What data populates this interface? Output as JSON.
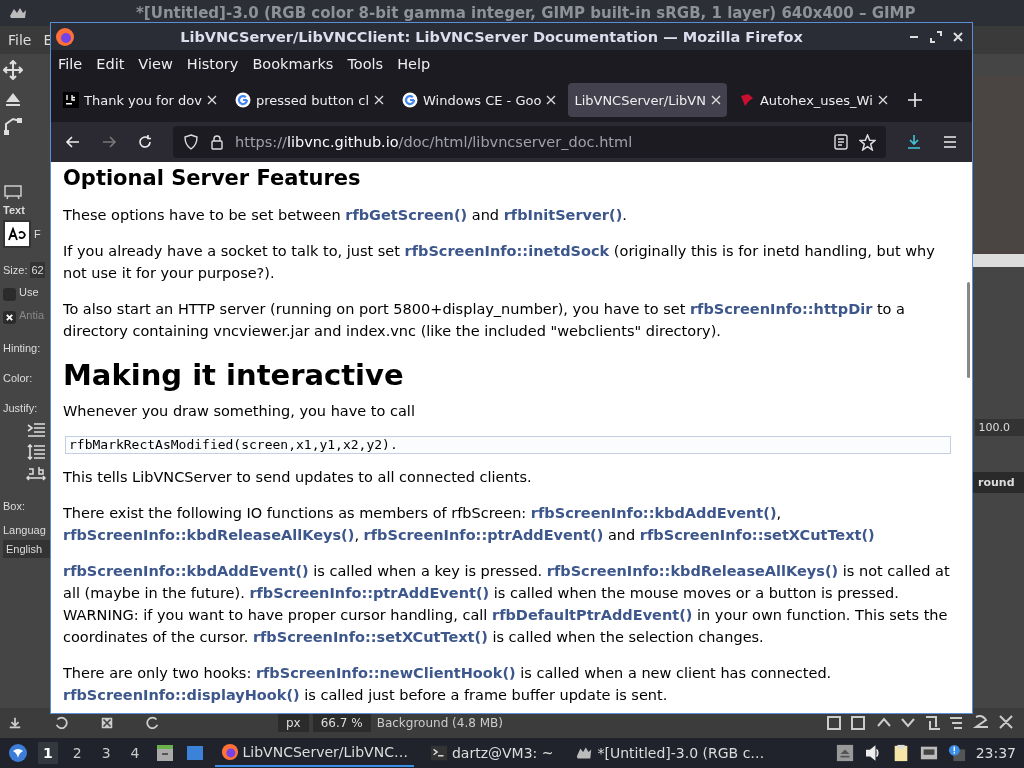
{
  "gimp": {
    "title": "*[Untitled]-3.0 (RGB color 8-bit gamma integer, GIMP built-in sRGB, 1 layer) 640x400 – GIMP",
    "menu": [
      "File",
      "E"
    ],
    "text_tool": {
      "heading": "Text",
      "font_label": "F",
      "size_label": "Size:",
      "size_value": "62",
      "use_editor": {
        "label": "Use",
        "checked": false
      },
      "antialias": {
        "label": "Antia",
        "checked": true
      },
      "hinting_label": "Hinting:",
      "color_label": "Color:",
      "justify_label": "Justify:",
      "box_label": "Box:",
      "language_label": "Languag",
      "language_value": "English"
    },
    "opacity_value": "100.0",
    "layer_name": "round",
    "status": {
      "unit": "px",
      "zoom": "66.7 %",
      "info": "Background (4.8 MB)"
    }
  },
  "firefox": {
    "title": "LibVNCServer/LibVNCClient: LibVNCServer Documentation — Mozilla Firefox",
    "menu": [
      "File",
      "Edit",
      "View",
      "History",
      "Bookmarks",
      "Tools",
      "Help"
    ],
    "tabs": [
      {
        "title": "Thank you for dov",
        "kind": "jb",
        "selected": false
      },
      {
        "title": "pressed button cl",
        "kind": "google",
        "selected": false
      },
      {
        "title": "Windows CE - Goo",
        "kind": "google",
        "selected": false
      },
      {
        "title": "LibVNCServer/LibVN",
        "kind": "plain",
        "selected": true
      },
      {
        "title": "Autohex_uses_Wi",
        "kind": "red",
        "selected": false
      }
    ],
    "url": {
      "scheme": "https://",
      "host": "libvnc.github.io",
      "path": "/doc/html/libvncserver_doc.html"
    },
    "content": [
      {
        "kind": "h2",
        "text": "Optional Server Features"
      },
      {
        "kind": "p",
        "parts": [
          {
            "t": "These options have to be set between ",
            "link": false
          },
          {
            "t": "rfbGetScreen()",
            "link": true
          },
          {
            "t": " and ",
            "link": false
          },
          {
            "t": "rfbInitServer()",
            "link": true
          },
          {
            "t": ".",
            "link": false
          }
        ]
      },
      {
        "kind": "p",
        "parts": [
          {
            "t": "If you already have a socket to talk to, just set ",
            "link": false
          },
          {
            "t": "rfbScreenInfo::inetdSock",
            "link": true
          },
          {
            "t": " (originally this is for inetd handling, but why not use it for your purpose?).",
            "link": false
          }
        ]
      },
      {
        "kind": "p",
        "parts": [
          {
            "t": "To also start an HTTP server (running on port 5800+display_number), you have to set ",
            "link": false
          },
          {
            "t": "rfbScreenInfo::httpDir",
            "link": true
          },
          {
            "t": " to a directory containing vncviewer.jar and index.vnc (like the included \"webclients\" directory).",
            "link": false
          }
        ]
      },
      {
        "kind": "h1",
        "text": "Making it interactive"
      },
      {
        "kind": "p",
        "parts": [
          {
            "t": "Whenever you draw something, you have to call",
            "link": false
          }
        ]
      },
      {
        "kind": "code",
        "text": "rfbMarkRectAsModified(screen,x1,y1,x2,y2)."
      },
      {
        "kind": "p",
        "parts": [
          {
            "t": "This tells LibVNCServer to send updates to all connected clients.",
            "link": false
          }
        ]
      },
      {
        "kind": "p",
        "parts": [
          {
            "t": "There exist the following IO functions as members of rfbScreen: ",
            "link": false
          },
          {
            "t": "rfbScreenInfo::kbdAddEvent()",
            "link": true
          },
          {
            "t": ", ",
            "link": false
          },
          {
            "t": "rfbScreenInfo::kbdReleaseAllKeys()",
            "link": true
          },
          {
            "t": ", ",
            "link": false
          },
          {
            "t": "rfbScreenInfo::ptrAddEvent()",
            "link": true
          },
          {
            "t": " and ",
            "link": false
          },
          {
            "t": "rfbScreenInfo::setXCutText()",
            "link": true
          }
        ]
      },
      {
        "kind": "p",
        "parts": [
          {
            "t": "rfbScreenInfo::kbdAddEvent()",
            "link": true
          },
          {
            "t": " is called when a key is pressed. ",
            "link": false
          },
          {
            "t": "rfbScreenInfo::kbdReleaseAllKeys()",
            "link": true
          },
          {
            "t": " is not called at all (maybe in the future). ",
            "link": false
          },
          {
            "t": "rfbScreenInfo::ptrAddEvent()",
            "link": true
          },
          {
            "t": " is called when the mouse moves or a button is pressed. WARNING: if you want to have proper cursor handling, call ",
            "link": false
          },
          {
            "t": "rfbDefaultPtrAddEvent()",
            "link": true
          },
          {
            "t": " in your own function. This sets the coordinates of the cursor. ",
            "link": false
          },
          {
            "t": "rfbScreenInfo::setXCutText()",
            "link": true
          },
          {
            "t": " is called when the selection changes.",
            "link": false
          }
        ]
      },
      {
        "kind": "p",
        "parts": [
          {
            "t": "There are only two hooks: ",
            "link": false
          },
          {
            "t": "rfbScreenInfo::newClientHook()",
            "link": true
          },
          {
            "t": " is called when a new client has connected. ",
            "link": false
          },
          {
            "t": "rfbScreenInfo::displayHook()",
            "link": true
          },
          {
            "t": " is called just before a frame buffer update is sent.",
            "link": false
          }
        ]
      }
    ]
  },
  "taskbar": {
    "workspaces": [
      {
        "label": "1",
        "selected": true
      },
      {
        "label": "2",
        "selected": false
      },
      {
        "label": "3",
        "selected": false
      },
      {
        "label": "4",
        "selected": false
      }
    ],
    "tasks": [
      {
        "title": "LibVNCServer/LibVNC…",
        "kind": "browser",
        "selected": true
      },
      {
        "title": "dartz@VM3: ~",
        "kind": "terminal",
        "selected": false
      },
      {
        "title": "*[Untitled]-3.0 (RGB c…",
        "kind": "editor",
        "selected": false
      }
    ],
    "clock": "23:37"
  }
}
